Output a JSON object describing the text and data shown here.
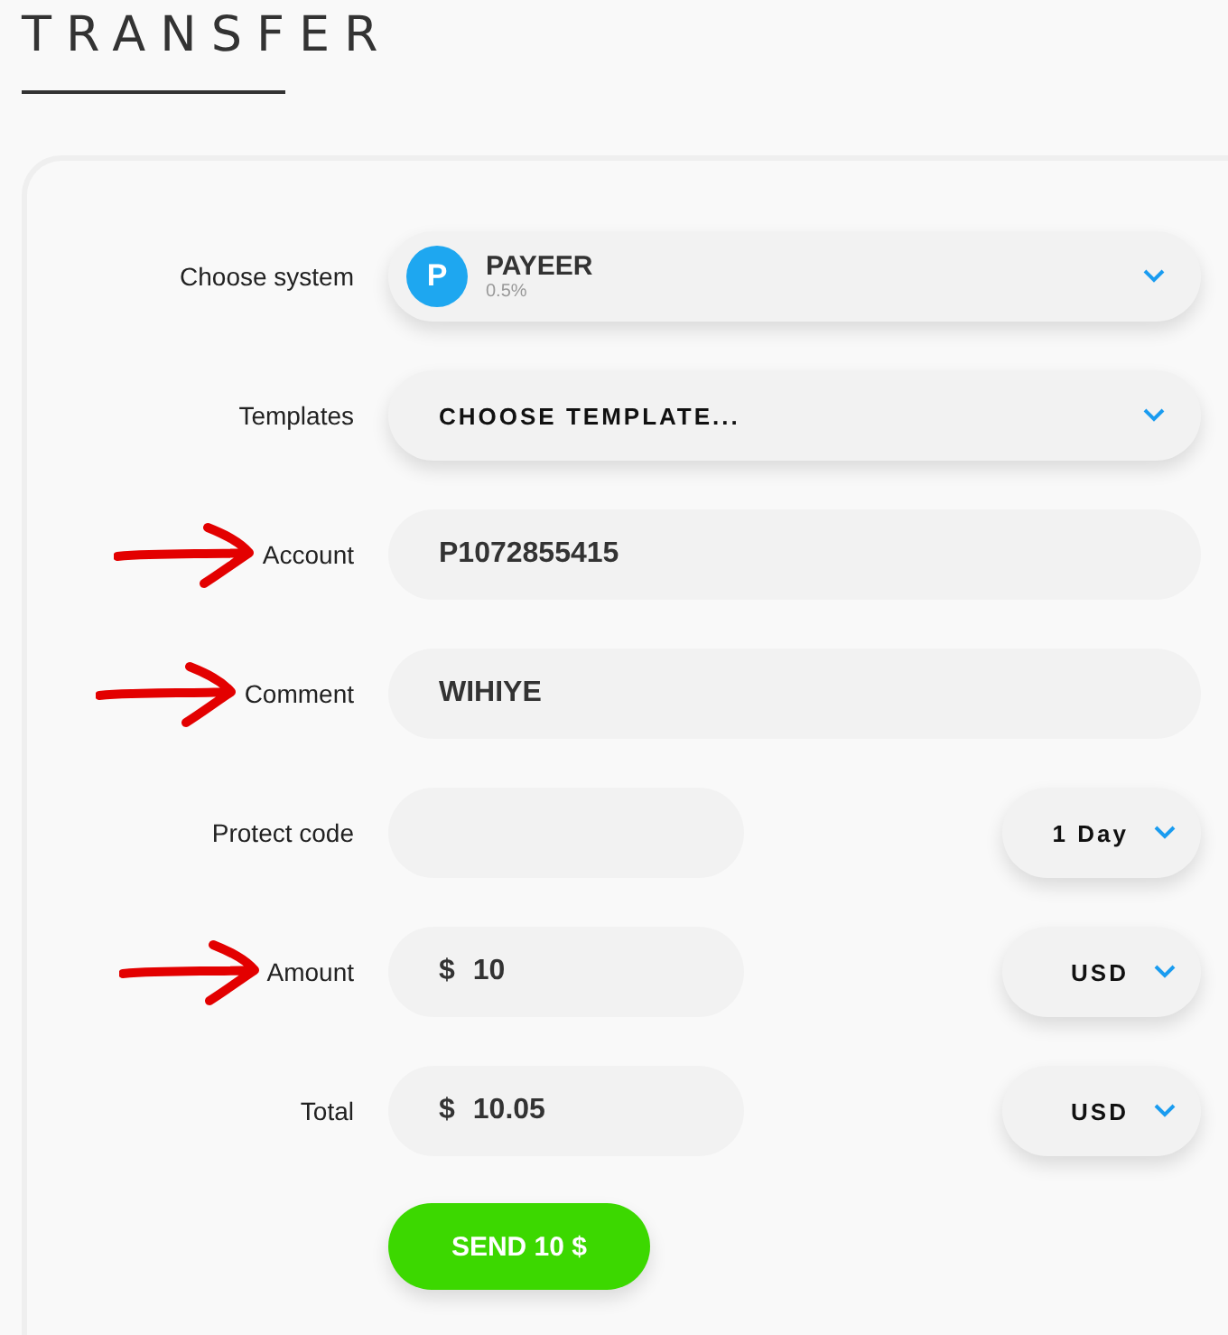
{
  "title": "TRANSFER",
  "rows": [
    {
      "kind": "system",
      "label": "Choose system",
      "marked": false,
      "name": "PAYEER",
      "fee": "0.5%",
      "logo": "P"
    },
    {
      "kind": "select",
      "label": "Templates",
      "marked": false,
      "value": "CHOOSE TEMPLATE..."
    },
    {
      "kind": "text",
      "label": "Account",
      "marked": true,
      "value": "P1072855415"
    },
    {
      "kind": "text",
      "label": "Comment",
      "marked": true,
      "value": "WIHIYE"
    },
    {
      "kind": "split",
      "label": "Protect code",
      "marked": false,
      "value": "",
      "option": "1 Day"
    },
    {
      "kind": "split",
      "label": "Amount",
      "marked": true,
      "prefix": "$",
      "value": "10",
      "option": "USD"
    },
    {
      "kind": "split",
      "label": "Total",
      "marked": false,
      "prefix": "$",
      "value": "10.05",
      "option": "USD"
    }
  ],
  "submit": "SEND 10 $"
}
